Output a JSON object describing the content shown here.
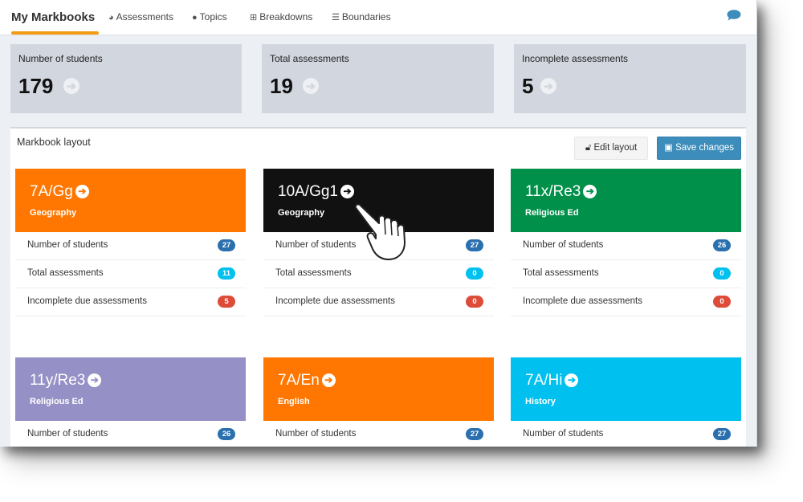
{
  "nav": {
    "title": "My Markbooks",
    "items": [
      {
        "label": "Assessments",
        "icon": "dashboard-icon"
      },
      {
        "label": "Topics",
        "icon": "group-icon"
      },
      {
        "label": "Breakdowns",
        "icon": "sitemap-icon"
      },
      {
        "label": "Boundaries",
        "icon": "list-icon"
      }
    ],
    "chat_icon": "comment-icon",
    "accent_color": "#f39c12"
  },
  "stats": [
    {
      "label": "Number of students",
      "value": "179"
    },
    {
      "label": "Total assessments",
      "value": "19"
    },
    {
      "label": "Incomplete assessments",
      "value": "5"
    }
  ],
  "layout": {
    "title": "Markbook layout",
    "edit_label": "Edit layout",
    "save_label": "Save changes"
  },
  "row_labels": {
    "students": "Number of students",
    "total": "Total assessments",
    "incomplete": "Incomplete due assessments"
  },
  "cards": [
    {
      "code": "7A/Gg",
      "subject": "Geography",
      "color": "#ff7700",
      "students": "27",
      "total": "11",
      "incomplete": "5"
    },
    {
      "code": "10A/Gg1",
      "subject": "Geography",
      "color": "#111111",
      "students": "27",
      "total": "0",
      "incomplete": "0"
    },
    {
      "code": "11x/Re3",
      "subject": "Religious Ed",
      "color": "#00904a",
      "students": "26",
      "total": "0",
      "incomplete": "0"
    },
    {
      "code": "11y/Re3",
      "subject": "Religious Ed",
      "color": "#9590c6",
      "students": "26"
    },
    {
      "code": "7A/En",
      "subject": "English",
      "color": "#ff7700",
      "students": "27"
    },
    {
      "code": "7A/Hi",
      "subject": "History",
      "color": "#00c0ef",
      "students": "27"
    }
  ]
}
